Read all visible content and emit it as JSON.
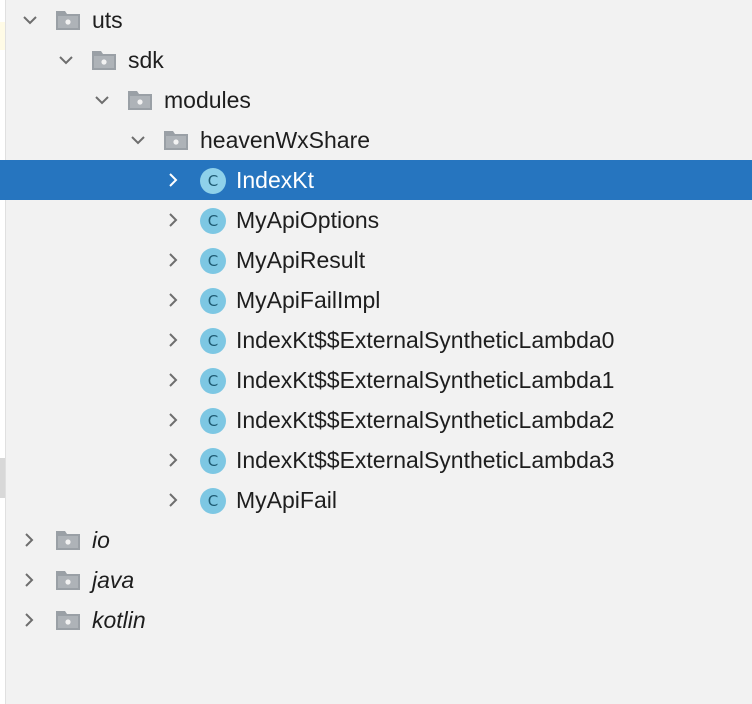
{
  "tree": {
    "uts": {
      "label": "uts",
      "icon": "package-folder-icon",
      "expanded": true
    },
    "sdk": {
      "label": "sdk",
      "icon": "package-folder-icon",
      "expanded": true
    },
    "modules": {
      "label": "modules",
      "icon": "package-folder-icon",
      "expanded": true
    },
    "heavenWxShare": {
      "label": "heavenWxShare",
      "icon": "package-folder-icon",
      "expanded": true
    },
    "classes": [
      {
        "label": "IndexKt",
        "icon_letter": "C",
        "selected": true
      },
      {
        "label": "MyApiOptions",
        "icon_letter": "C"
      },
      {
        "label": "MyApiResult",
        "icon_letter": "C"
      },
      {
        "label": "MyApiFailImpl",
        "icon_letter": "C"
      },
      {
        "label": "IndexKt$$ExternalSyntheticLambda0",
        "icon_letter": "C"
      },
      {
        "label": "IndexKt$$ExternalSyntheticLambda1",
        "icon_letter": "C"
      },
      {
        "label": "IndexKt$$ExternalSyntheticLambda2",
        "icon_letter": "C"
      },
      {
        "label": "IndexKt$$ExternalSyntheticLambda3",
        "icon_letter": "C"
      },
      {
        "label": "MyApiFail",
        "icon_letter": "C"
      }
    ],
    "roots": [
      {
        "label": "io",
        "expanded": false
      },
      {
        "label": "java",
        "expanded": false
      },
      {
        "label": "kotlin",
        "expanded": false
      }
    ]
  },
  "colors": {
    "background": "#f2f2f2",
    "selection": "#2675bf",
    "class_icon": "#7dc7e3",
    "folder_icon": "#9aa0a6"
  }
}
